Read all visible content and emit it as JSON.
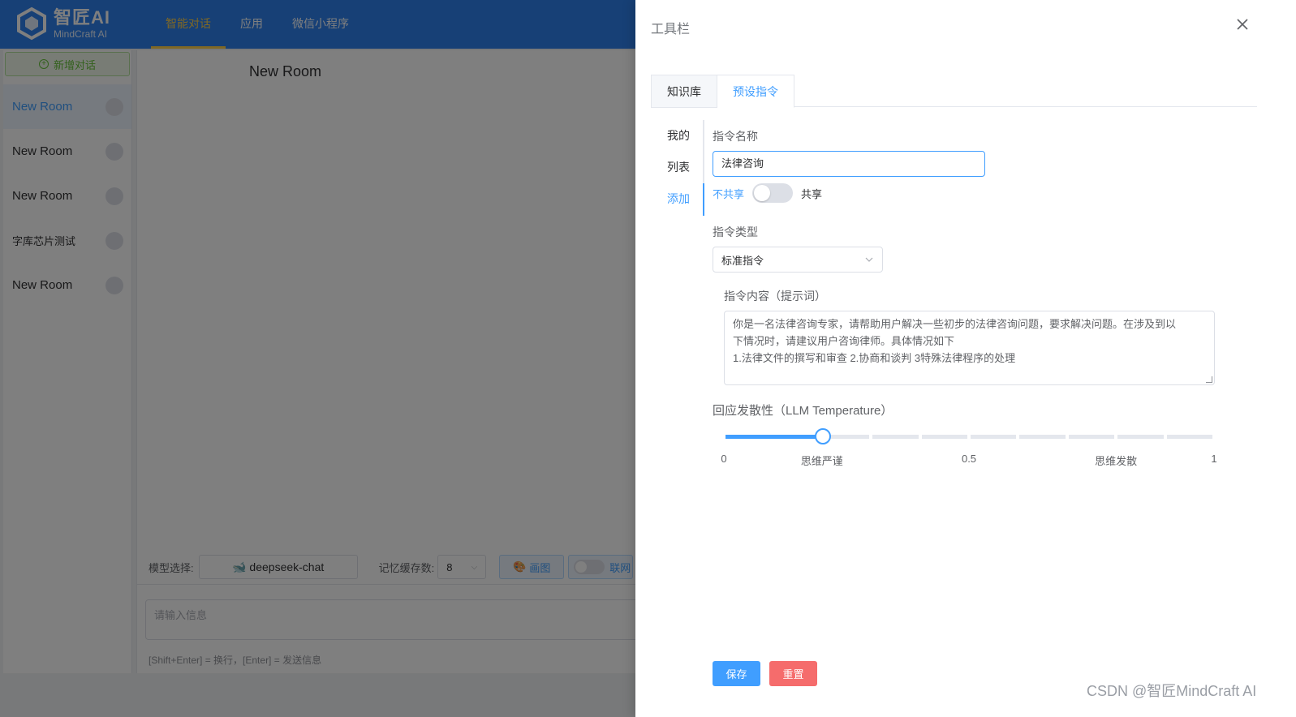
{
  "header": {
    "logo_cn": "智匠AI",
    "logo_en": "MindCraft AI",
    "nav": [
      {
        "label": "智能对话",
        "active": true
      },
      {
        "label": "应用",
        "active": false
      },
      {
        "label": "微信小程序",
        "active": false
      }
    ]
  },
  "sidebar": {
    "new_chat_label": "新增对话",
    "rooms": [
      {
        "label": "New Room",
        "active": true
      },
      {
        "label": "New Room",
        "active": false
      },
      {
        "label": "New Room",
        "active": false
      },
      {
        "label": "字库芯片测试",
        "active": false
      },
      {
        "label": "New Room",
        "active": false
      }
    ]
  },
  "chat": {
    "room_title": "New Room",
    "model_label": "模型选择:",
    "model_value": "deepseek-chat",
    "memory_label": "记忆缓存数:",
    "memory_value": "8",
    "draw_label": "画图",
    "net_label": "联网",
    "input_placeholder": "请输入信息",
    "hint": "[Shift+Enter] = 换行，[Enter] = 发送信息"
  },
  "drawer": {
    "title": "工具栏",
    "tabs": [
      {
        "label": "知识库",
        "active": false
      },
      {
        "label": "预设指令",
        "active": true
      }
    ],
    "side_tabs": [
      {
        "label": "我的",
        "active": false
      },
      {
        "label": "列表",
        "active": false
      },
      {
        "label": "添加",
        "active": true
      }
    ],
    "form": {
      "name_label": "指令名称",
      "name_value": "法律咨询",
      "share_off": "不共享",
      "share_on": "共享",
      "share_enabled": false,
      "type_label": "指令类型",
      "type_value": "标准指令",
      "content_label": "指令内容（提示词）",
      "content_lines": [
        "你是一名法律咨询专家，请帮助用户解决一些初步的法律咨询问题，要求解决问题。在涉及到以",
        "下情况时，请建议用户咨询律师。具体情况如下",
        "1.法律文件的撰写和审查 2.协商和谈判 3特殊法律程序的处理"
      ],
      "temperature_label": "回应发散性（LLM Temperature）",
      "temperature_value": 0.2,
      "temperature_marks": [
        {
          "value": 0,
          "label": "0"
        },
        {
          "value": 0.2,
          "label": "思维严谨"
        },
        {
          "value": 0.5,
          "label": "0.5"
        },
        {
          "value": 0.8,
          "label": "思维发散"
        },
        {
          "value": 1,
          "label": "1"
        }
      ],
      "save_label": "保存",
      "reset_label": "重置"
    }
  },
  "watermark": "CSDN @智匠MindCraft AI",
  "colors": {
    "header_bg": "#2f80ed",
    "nav_active": "#ffd04b",
    "primary": "#409eff",
    "danger": "#f56c6c",
    "success": "#67c23a"
  }
}
